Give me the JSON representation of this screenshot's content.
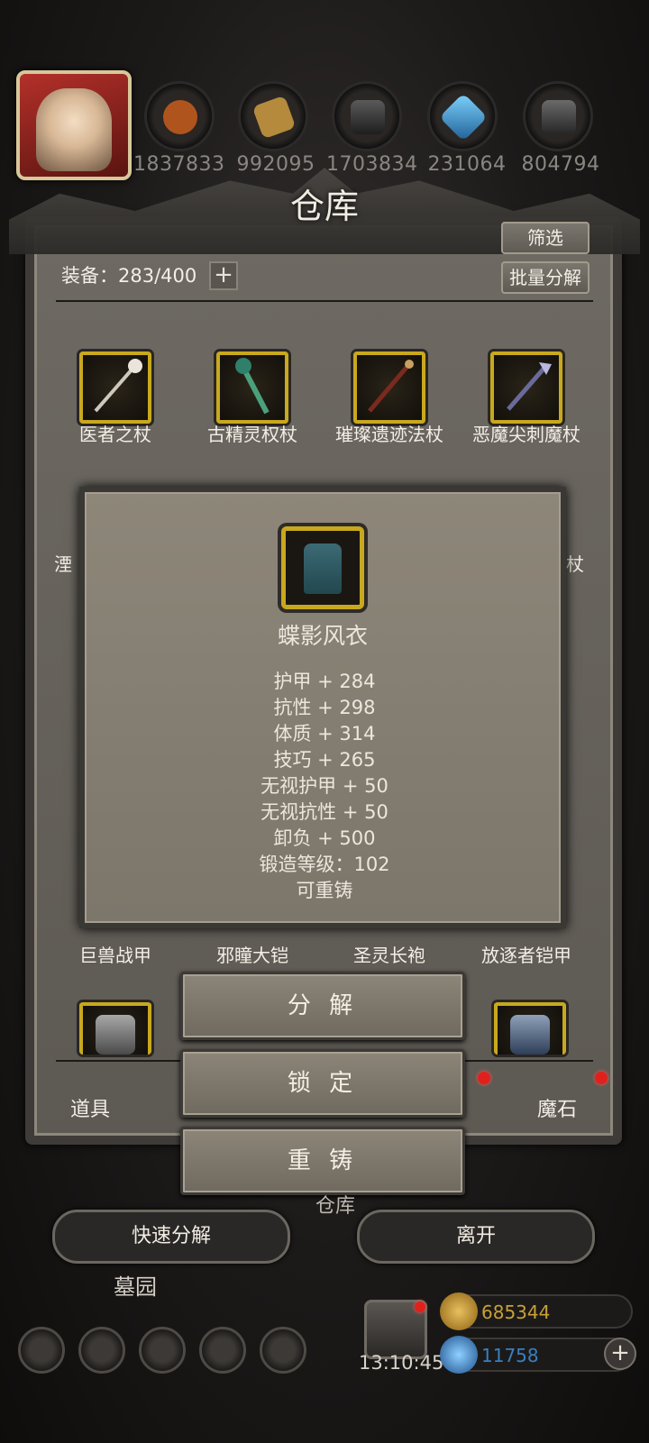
{
  "resources": [
    {
      "name": "wood",
      "value": "1837833",
      "color": "#b0541e"
    },
    {
      "name": "planks",
      "value": "992095",
      "color": "#b58a3c"
    },
    {
      "name": "iron",
      "value": "1703834",
      "color": "#3c3c3c"
    },
    {
      "name": "crystal",
      "value": "231064",
      "color": "#2f8fc4"
    },
    {
      "name": "steel",
      "value": "804794",
      "color": "#4a4a4a"
    }
  ],
  "panel": {
    "title": "仓库",
    "filter_label": "筛选",
    "batch_decompose_label": "批量分解",
    "equip_count": "装备：283/400",
    "add_label": "+"
  },
  "items_row1": [
    "医者之杖",
    "古精灵权杖",
    "璀璨遗迹法杖",
    "恶魔尖刺魔杖"
  ],
  "items_row_bottom": [
    "巨兽战甲",
    "邪瞳大铠",
    "圣灵长袍",
    "放逐者铠甲"
  ],
  "partial_labels": {
    "left": "湮",
    "right": "杖"
  },
  "popup": {
    "item_name": "蝶影风衣",
    "stats": [
      "护甲 + 284",
      "抗性 + 298",
      "体质 + 314",
      "技巧 + 265",
      "无视护甲 + 50",
      "无视抗性 + 50",
      "卸负 + 500",
      "锻造等级：102",
      "可重铸"
    ]
  },
  "actions": {
    "decompose": "分 解",
    "lock": "锁 定",
    "recast": "重 铸"
  },
  "tabs": {
    "items": "道具",
    "magic_stone": "魔石",
    "warehouse": "仓库"
  },
  "bottom_buttons": {
    "quick_decompose": "快速分解",
    "leave": "离开"
  },
  "location": "墓园",
  "timer": "13:10:45",
  "currency": {
    "gold": "685344",
    "gem": "11758",
    "gold_color": "#c8a038",
    "gem_color": "#3a7fc0"
  },
  "colors": {
    "rarity_gold": "#c8a81e",
    "badge_red": "#e0201c"
  }
}
